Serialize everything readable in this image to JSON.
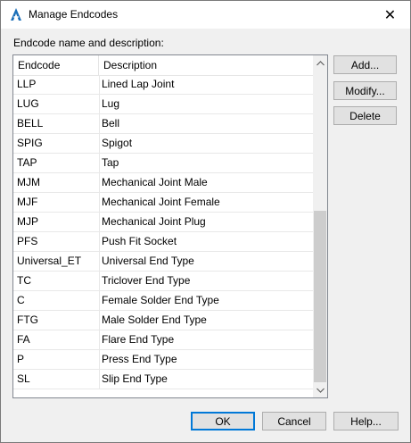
{
  "window": {
    "title": "Manage Endcodes",
    "close_glyph": "✕",
    "icon": "autocad-a-icon",
    "accent_color": "#1b6fb8"
  },
  "list": {
    "group_label": "Endcode name and description:",
    "columns": [
      "Endcode",
      "Description"
    ],
    "rows": [
      {
        "code": "LLP",
        "desc": "Lined Lap Joint"
      },
      {
        "code": "LUG",
        "desc": "Lug"
      },
      {
        "code": "BELL",
        "desc": "Bell"
      },
      {
        "code": "SPIG",
        "desc": "Spigot"
      },
      {
        "code": "TAP",
        "desc": "Tap"
      },
      {
        "code": "MJM",
        "desc": "Mechanical Joint Male"
      },
      {
        "code": "MJF",
        "desc": "Mechanical Joint Female"
      },
      {
        "code": "MJP",
        "desc": "Mechanical Joint Plug"
      },
      {
        "code": "PFS",
        "desc": "Push Fit Socket"
      },
      {
        "code": "Universal_ET",
        "desc": "Universal End Type"
      },
      {
        "code": "TC",
        "desc": "Triclover End Type"
      },
      {
        "code": "C",
        "desc": "Female Solder End Type"
      },
      {
        "code": "FTG",
        "desc": "Male Solder End Type"
      },
      {
        "code": "FA",
        "desc": "Flare End Type"
      },
      {
        "code": "P",
        "desc": "Press End Type"
      },
      {
        "code": "SL",
        "desc": "Slip End Type"
      }
    ],
    "scroll_position": 1.0,
    "scroll_visible_fraction": 0.55
  },
  "buttons": {
    "add": "Add...",
    "modify": "Modify...",
    "delete": "Delete",
    "ok": "OK",
    "cancel": "Cancel",
    "help": "Help..."
  }
}
